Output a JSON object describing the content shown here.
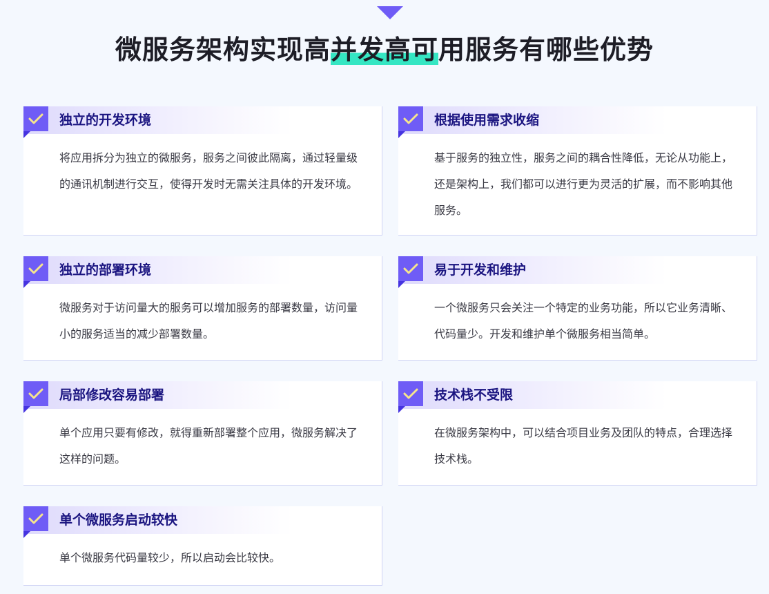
{
  "header": {
    "title_before": "微服务架构实现高",
    "title_highlight": "并发高可",
    "title_after": "用服务有哪些优势",
    "accent_color": "#6f5cf6",
    "highlight_color": "#35e6c3"
  },
  "cards": [
    {
      "title": "独立的开发环境",
      "desc": "将应用拆分为独立的微服务，服务之间彼此隔离，通过轻量级的通讯机制进行交互，使得开发时无需关注具体的开发环境。",
      "icon": "checkmark-icon"
    },
    {
      "title": "根据使用需求收缩",
      "desc": "基于服务的独立性，服务之间的耦合性降低，无论从功能上，还是架构上，我们都可以进行更为灵活的扩展，而不影响其他服务。",
      "icon": "checkmark-icon"
    },
    {
      "title": "独立的部署环境",
      "desc": "微服务对于访问量大的服务可以增加服务的部署数量，访问量小的服务适当的减少部署数量。",
      "icon": "checkmark-icon"
    },
    {
      "title": "易于开发和维护",
      "desc": "一个微服务只会关注一个特定的业务功能，所以它业务清晰、代码量少。开发和维护单个微服务相当简单。",
      "icon": "checkmark-icon"
    },
    {
      "title": "局部修改容易部署",
      "desc": "单个应用只要有修改，就得重新部署整个应用，微服务解决了这样的问题。",
      "icon": "checkmark-icon"
    },
    {
      "title": "技术栈不受限",
      "desc": "在微服务架构中，可以结合项目业务及团队的特点，合理选择技术栈。",
      "icon": "checkmark-icon"
    },
    {
      "title": "单个微服务启动较快",
      "desc": "单个微服务代码量较少，所以启动会比较快。",
      "icon": "checkmark-icon"
    }
  ]
}
